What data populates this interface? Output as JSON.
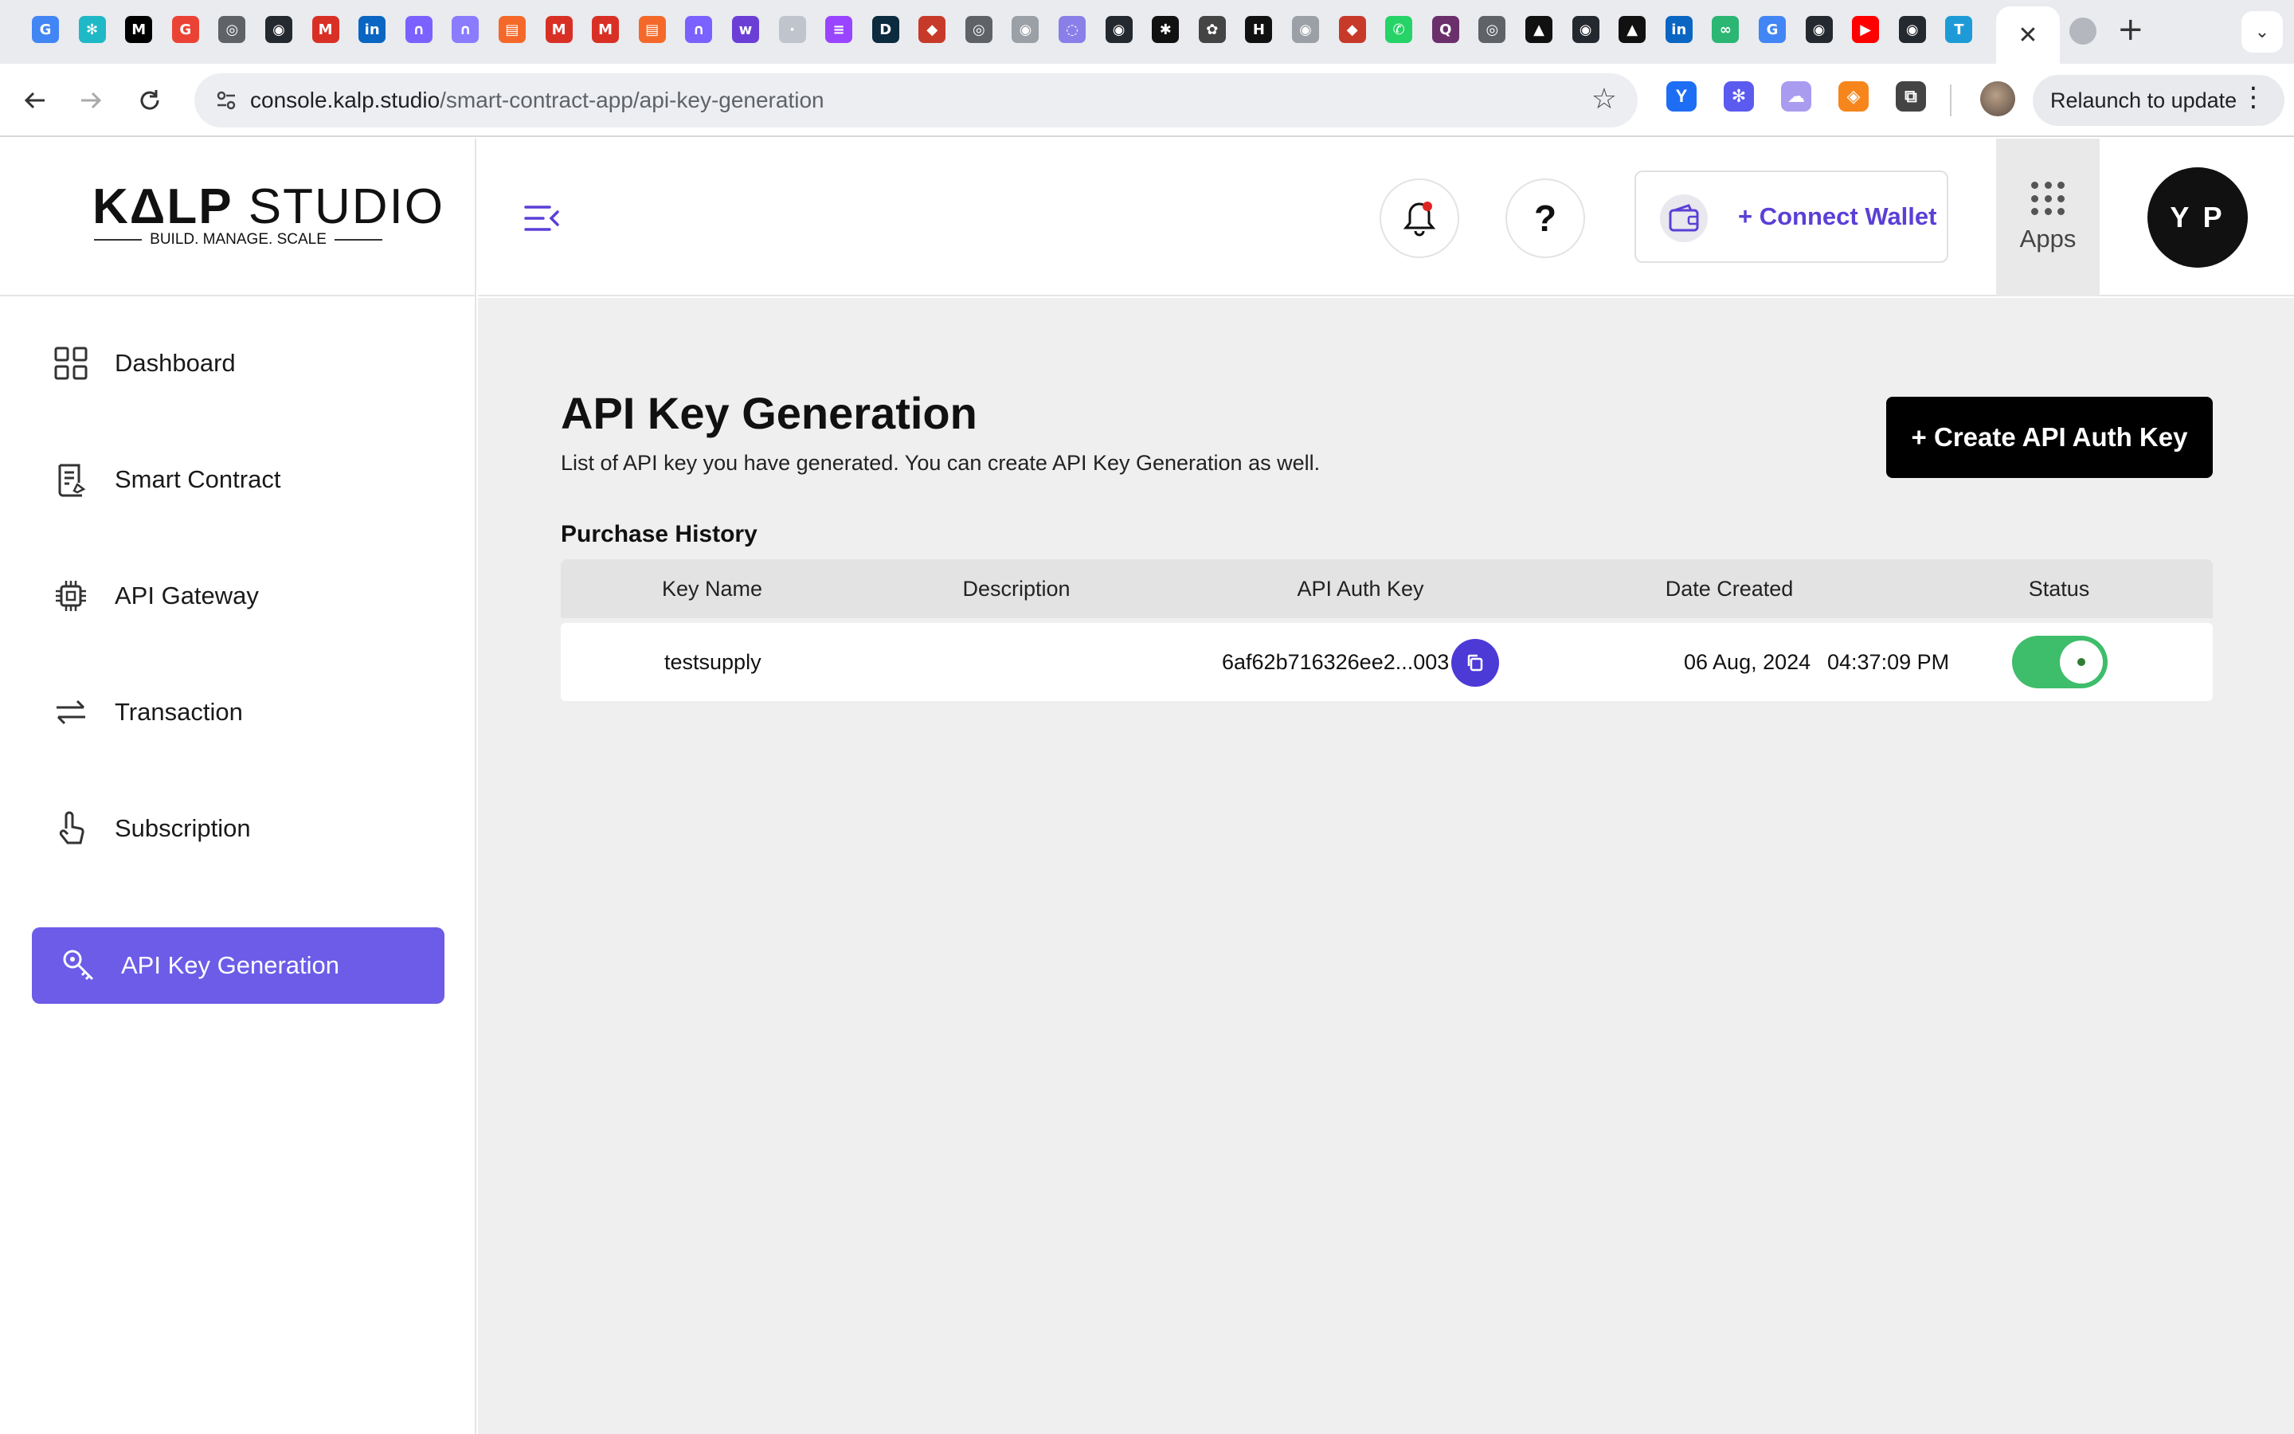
{
  "browser": {
    "tab_icons": [
      {
        "name": "google-icon",
        "glyph": "G",
        "color": "#4285f4"
      },
      {
        "name": "sparkle-icon",
        "glyph": "✻",
        "color": "#1fb8c6"
      },
      {
        "name": "medium-icon",
        "glyph": "M",
        "color": "#000000"
      },
      {
        "name": "google-icon",
        "glyph": "G",
        "color": "#ea4335"
      },
      {
        "name": "chrome-icon",
        "glyph": "◎",
        "color": "#5f6368"
      },
      {
        "name": "github-icon",
        "glyph": "◉",
        "color": "#24292f"
      },
      {
        "name": "gmail-icon",
        "glyph": "M",
        "color": "#d93025"
      },
      {
        "name": "linkedin-icon",
        "glyph": "in",
        "color": "#0a66c2"
      },
      {
        "name": "notion-icon",
        "glyph": "∩",
        "color": "#7b61ff"
      },
      {
        "name": "notion-icon",
        "glyph": "∩",
        "color": "#8b7bff"
      },
      {
        "name": "bookmark-icon",
        "glyph": "▤",
        "color": "#f4692a"
      },
      {
        "name": "gmail-icon",
        "glyph": "M",
        "color": "#d93025"
      },
      {
        "name": "gmail-icon",
        "glyph": "M",
        "color": "#d93025"
      },
      {
        "name": "bookmark-icon",
        "glyph": "▤",
        "color": "#f4692a"
      },
      {
        "name": "notion-icon",
        "glyph": "∩",
        "color": "#7b61ff"
      },
      {
        "name": "w-icon",
        "glyph": "w",
        "color": "#6b3fd6"
      },
      {
        "name": "dash-icon",
        "glyph": "·",
        "color": "#c0c4cc"
      },
      {
        "name": "solana-icon",
        "glyph": "≡",
        "color": "#9945ff"
      },
      {
        "name": "d-icon",
        "glyph": "D",
        "color": "#0d2b3e"
      },
      {
        "name": "shield-icon",
        "glyph": "◆",
        "color": "#c73a2a"
      },
      {
        "name": "chrome-icon",
        "glyph": "◎",
        "color": "#5f6368"
      },
      {
        "name": "github-icon",
        "glyph": "◉",
        "color": "#9aa0a6"
      },
      {
        "name": "circle-icon",
        "glyph": "◌",
        "color": "#8a7fe8"
      },
      {
        "name": "github-icon",
        "glyph": "◉",
        "color": "#24292f"
      },
      {
        "name": "asterisk-icon",
        "glyph": "✱",
        "color": "#111111"
      },
      {
        "name": "openai-icon",
        "glyph": "✿",
        "color": "#444444"
      },
      {
        "name": "h-icon",
        "glyph": "H",
        "color": "#111111"
      },
      {
        "name": "github-icon",
        "glyph": "◉",
        "color": "#9aa0a6"
      },
      {
        "name": "shield-icon",
        "glyph": "◆",
        "color": "#c73a2a"
      },
      {
        "name": "whatsapp-icon",
        "glyph": "✆",
        "color": "#25d366"
      },
      {
        "name": "q-icon",
        "glyph": "Q",
        "color": "#6b2f6b"
      },
      {
        "name": "chrome-icon",
        "glyph": "◎",
        "color": "#5f6368"
      },
      {
        "name": "triangle-icon",
        "glyph": "▲",
        "color": "#111111"
      },
      {
        "name": "github-icon",
        "glyph": "◉",
        "color": "#24292f"
      },
      {
        "name": "triangle-icon",
        "glyph": "▲",
        "color": "#111111"
      },
      {
        "name": "linkedin-icon",
        "glyph": "in",
        "color": "#0a66c2"
      },
      {
        "name": "infinity-icon",
        "glyph": "∞",
        "color": "#2bb673"
      },
      {
        "name": "google-icon",
        "glyph": "G",
        "color": "#4285f4"
      },
      {
        "name": "github-icon",
        "glyph": "◉",
        "color": "#24292f"
      },
      {
        "name": "youtube-icon",
        "glyph": "▶",
        "color": "#ff0000"
      },
      {
        "name": "github-icon",
        "glyph": "◉",
        "color": "#24292f"
      },
      {
        "name": "t-icon",
        "glyph": "T",
        "color": "#1e9bd7"
      }
    ],
    "close_tab_label": "✕",
    "new_tab_label": "+",
    "tab_menu_label": "⌄",
    "url_host": "console.kalp.studio",
    "url_path": "/smart-contract-app/api-key-generation",
    "relaunch_label": "Relaunch to update",
    "extensions": [
      {
        "name": "y-extension-icon",
        "glyph": "Y",
        "color": "#1e6ef5"
      },
      {
        "name": "snowflake-extension-icon",
        "glyph": "✻",
        "color": "#5b5bf0"
      },
      {
        "name": "ghost-extension-icon",
        "glyph": "☁",
        "color": "#a99bf0"
      },
      {
        "name": "metamask-extension-icon",
        "glyph": "◈",
        "color": "#f6851b"
      },
      {
        "name": "puzzle-extension-icon",
        "glyph": "⧉",
        "color": "#444444"
      }
    ]
  },
  "brand": {
    "logo_bold": "K",
    "logo_mark": "Δ",
    "logo_bold2": "LP",
    "logo_light": " STUDIO",
    "tagline": "BUILD. MANAGE. SCALE",
    "accent": "#6c5ce7"
  },
  "sidebar": {
    "items": [
      {
        "label": "Dashboard",
        "icon": "dashboard-icon",
        "active": false
      },
      {
        "label": "Smart Contract",
        "icon": "contract-icon",
        "active": false
      },
      {
        "label": "API Gateway",
        "icon": "chip-icon",
        "active": false
      },
      {
        "label": "Transaction",
        "icon": "transfer-icon",
        "active": false
      },
      {
        "label": "Subscription",
        "icon": "pointer-icon",
        "active": false
      },
      {
        "label": "API Key Generation",
        "icon": "key-icon",
        "active": true
      }
    ]
  },
  "header": {
    "help_label": "?",
    "connect_wallet": "+ Connect Wallet",
    "apps_label": "Apps",
    "avatar_initials": "Y P"
  },
  "page": {
    "title": "API Key Generation",
    "subtitle": "List of API key you have generated. You can create API Key Generation as well.",
    "create_button": "+ Create API Auth Key",
    "section_title": "Purchase History",
    "columns": [
      "Key Name",
      "Description",
      "API Auth Key",
      "Date Created",
      "Status"
    ],
    "rows": [
      {
        "key_name": "testsupply",
        "description": "",
        "api_key": "6af62b716326ee2...003",
        "date": "06 Aug, 2024",
        "time": "04:37:09 PM",
        "status_on": true
      }
    ]
  }
}
